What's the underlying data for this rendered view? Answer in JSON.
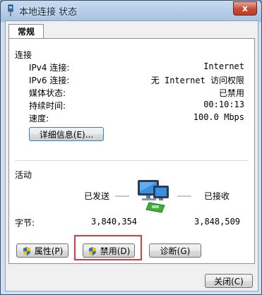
{
  "window": {
    "title": "本地连接 状态",
    "close_label": "x"
  },
  "tabs": [
    {
      "label": "常规"
    }
  ],
  "connection": {
    "section_label": "连接",
    "rows": [
      {
        "label": "IPv4 连接:",
        "value": "Internet"
      },
      {
        "label": "IPv6 连接:",
        "value": "无 Internet 访问权限"
      },
      {
        "label": "媒体状态:",
        "value": "已禁用"
      },
      {
        "label": "持续时间:",
        "value": "00:10:13"
      },
      {
        "label": "速度:",
        "value": "100.0 Mbps"
      }
    ],
    "details_button": "详细信息(E)..."
  },
  "activity": {
    "section_label": "活动",
    "sent_label": "已发送",
    "received_label": "已接收",
    "bytes_label": "字节:",
    "bytes_sent": "3,840,354",
    "bytes_received": "3,848,509"
  },
  "buttons": {
    "properties": "属性(P)",
    "disable": "禁用(D)",
    "diagnose": "诊断(G)",
    "close": "关闭(C)"
  },
  "icons": {
    "title": "network-connection-icon",
    "shield": "uac-shield-icon",
    "activity": "network-computer-icon"
  }
}
